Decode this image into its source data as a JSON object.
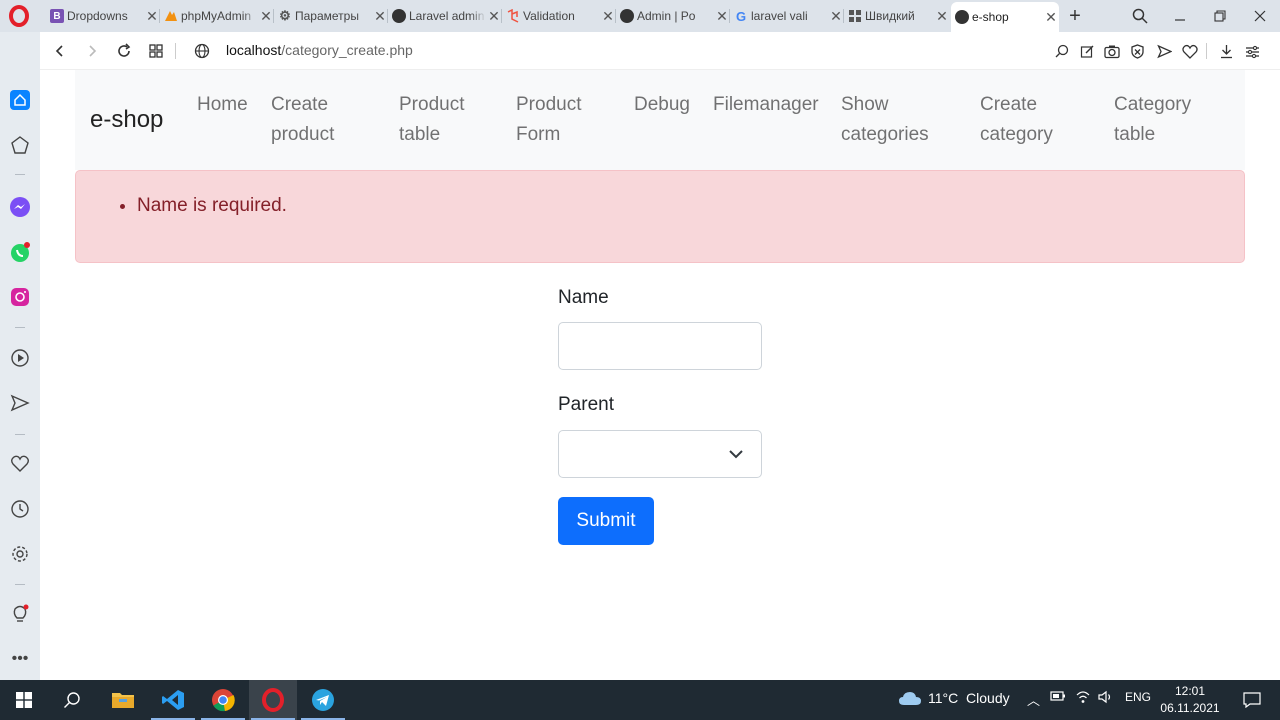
{
  "browser": {
    "tabs": [
      {
        "title": "Dropdowns",
        "icon": "bootstrap-icon",
        "color": "#7952b3"
      },
      {
        "title": "phpMyAdmin",
        "icon": "phpmyadmin-icon",
        "color": "#f29111"
      },
      {
        "title": "Параметры",
        "icon": "gear-icon",
        "color": "#555555"
      },
      {
        "title": "Laravel admin",
        "icon": "globe-icon",
        "color": "#333333"
      },
      {
        "title": "Validation",
        "icon": "laravel-icon",
        "color": "#f05340"
      },
      {
        "title": "Admin | Po",
        "icon": "globe-icon",
        "color": "#333333"
      },
      {
        "title": "laravel vali",
        "icon": "google-icon",
        "color": "#4285f4"
      },
      {
        "title": "Швидкий",
        "icon": "grid-icon",
        "color": "#555555"
      },
      {
        "title": "e-shop",
        "icon": "globe-icon",
        "color": "#333333"
      }
    ],
    "url_host": "localhost",
    "url_path": "/category_create.php"
  },
  "page": {
    "brand": "e-shop",
    "nav": [
      {
        "line1": "Home",
        "line2": ""
      },
      {
        "line1": "Create",
        "line2": "product"
      },
      {
        "line1": "Product",
        "line2": "table"
      },
      {
        "line1": "Product",
        "line2": "Form"
      },
      {
        "line1": "Debug",
        "line2": ""
      },
      {
        "line1": "Filemanager",
        "line2": ""
      },
      {
        "line1": "Show",
        "line2": "categories"
      },
      {
        "line1": "Create",
        "line2": "category"
      },
      {
        "line1": "Category",
        "line2": "table"
      }
    ],
    "errors": [
      "Name is required."
    ],
    "form": {
      "name_label": "Name",
      "name_value": "",
      "parent_label": "Parent",
      "parent_value": "",
      "submit_label": "Submit"
    }
  },
  "taskbar": {
    "weather": "11°C  Cloudy",
    "language": "ENG",
    "time": "12:01",
    "date": "06.11.2021"
  },
  "colors": {
    "primary": "#0d6efd",
    "alert_bg": "#f8d7da",
    "alert_text": "#842029",
    "opera_red": "#e3202a",
    "taskbar": "#1f2a33"
  }
}
